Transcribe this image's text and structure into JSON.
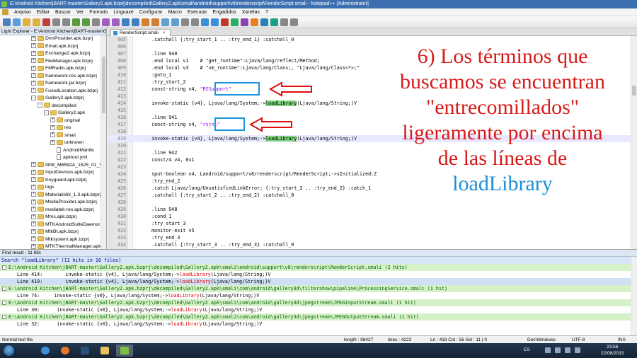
{
  "window": {
    "title": "E:\\Android Kitchen\\jBART-master\\Gallery2.apk.bzprj\\decompiled\\Gallery2.apk\\smali\\android\\support\\v8\\renderscript\\RenderScript.smali - Notepad++ [Administrator]"
  },
  "menu": [
    "Arquivo",
    "Editar",
    "Buscar",
    "Ver",
    "Formato",
    "Linguaxe",
    "Configurar",
    "Macro",
    "Executar",
    "Engadidos",
    "Xanelas",
    "?"
  ],
  "explorer": {
    "title": "Light Explorer - E:\\Android Kitchen\\jBART-master\\G...",
    "items": [
      {
        "label": "DrmProvider.apk.bzprj",
        "level": 3,
        "kind": "folder",
        "expander": "+"
      },
      {
        "label": "Email.apk.bzprj",
        "level": 3,
        "kind": "folder",
        "expander": "+"
      },
      {
        "label": "Exchange2.apk.bzprj",
        "level": 3,
        "kind": "folder",
        "expander": "+"
      },
      {
        "label": "FileManager.apk.bzprj",
        "level": 3,
        "kind": "folder",
        "expander": "+"
      },
      {
        "label": "FMRadio.apk.bzprj",
        "level": 3,
        "kind": "folder",
        "expander": "+"
      },
      {
        "label": "framework-res.apk.bzprj",
        "level": 3,
        "kind": "folder",
        "expander": "+"
      },
      {
        "label": "framework.jar.bzprj",
        "level": 3,
        "kind": "folder",
        "expander": "+"
      },
      {
        "label": "FusedLocation.apk.bzprj",
        "level": 3,
        "kind": "folder",
        "expander": "+"
      },
      {
        "label": "Gallery2.apk.bzprj",
        "level": 3,
        "kind": "folder",
        "expander": "-"
      },
      {
        "label": "decompiled",
        "level": 4,
        "kind": "folder",
        "expander": "-"
      },
      {
        "label": "Gallery2.apk",
        "level": 5,
        "kind": "folder",
        "expander": "-"
      },
      {
        "label": "original",
        "level": 6,
        "kind": "folder",
        "expander": "+"
      },
      {
        "label": "res",
        "level": 6,
        "kind": "folder",
        "expander": "+"
      },
      {
        "label": "smali",
        "level": 6,
        "kind": "folder",
        "expander": "+"
      },
      {
        "label": "unknown",
        "level": 6,
        "kind": "folder",
        "expander": "+"
      },
      {
        "label": "AndroidManife",
        "level": 6,
        "kind": "file",
        "expander": ""
      },
      {
        "label": "apktool.yml",
        "level": 6,
        "kind": "file",
        "expander": ""
      },
      {
        "label": "I908_M6592A_1525_01_V31",
        "level": 3,
        "kind": "folder",
        "expander": "+"
      },
      {
        "label": "InputDevices.apk.bzprj",
        "level": 3,
        "kind": "folder",
        "expander": "+"
      },
      {
        "label": "Keyguard.apk.bzprj",
        "level": 3,
        "kind": "folder",
        "expander": "+"
      },
      {
        "label": "logs",
        "level": 3,
        "kind": "folder",
        "expander": "+"
      },
      {
        "label": "Materialistik_1.3.apk.bzprj",
        "level": 3,
        "kind": "folder",
        "expander": "+"
      },
      {
        "label": "MediaProvider.apk.bzprj",
        "level": 3,
        "kind": "folder",
        "expander": "+"
      },
      {
        "label": "mediatek-res.apk.bzprj",
        "level": 3,
        "kind": "folder",
        "expander": "+"
      },
      {
        "label": "Mms.apk.bzprj",
        "level": 3,
        "kind": "folder",
        "expander": "+"
      },
      {
        "label": "MTKAndroidSuiteDaemor",
        "level": 3,
        "kind": "folder",
        "expander": "+"
      },
      {
        "label": "MtkBt.apk.bzprj",
        "level": 3,
        "kind": "folder",
        "expander": "+"
      },
      {
        "label": "Mtksystem.apk.bzprj",
        "level": 3,
        "kind": "folder",
        "expander": "+"
      },
      {
        "label": "MTKThermalManager.apk",
        "level": 3,
        "kind": "folder",
        "expander": "+"
      }
    ]
  },
  "tab": {
    "label": "RenderScript.smali",
    "close": "×"
  },
  "editor": {
    "current_line": 419,
    "lines": [
      {
        "n": "405",
        "text": "    .catchall {:try_start_1 .. :try_end_1} :catchall_0"
      },
      {
        "n": "406",
        "text": ""
      },
      {
        "n": "407",
        "text": "    .line 940"
      },
      {
        "n": "408",
        "text": "    .end local v1    # \"get_runtime\":Ljava/lang/reflect/Method;"
      },
      {
        "n": "409",
        "text": "    .end local v3    # \"vm_runtime\":Ljava/lang/Class;, \"Ljava/lang/Class<*>;\""
      },
      {
        "n": "410",
        "text": "    :goto_1"
      },
      {
        "n": "411",
        "text": "    :try_start_2"
      },
      {
        "n": "412",
        "pre": "    const-string v4, ",
        "quote": "\"RSSupport\"",
        "post": ""
      },
      {
        "n": "413",
        "text": ""
      },
      {
        "n": "414",
        "pre": "    invoke-static {v4}, Ljava/lang/System;->",
        "hl": "loadLibrary",
        "post": "(Ljava/lang/String;)V"
      },
      {
        "n": "415",
        "text": ""
      },
      {
        "n": "416",
        "text": "    .line 941"
      },
      {
        "n": "417",
        "pre": "    const-string v4, ",
        "quote": "\"rsjni\"",
        "post": ""
      },
      {
        "n": "418",
        "text": ""
      },
      {
        "n": "419",
        "pre": "    invoke-static {v4}, Ljava/lang/System;->",
        "hl": "loadLibrary",
        "post": "(Ljava/lang/String;)V"
      },
      {
        "n": "420",
        "text": ""
      },
      {
        "n": "421",
        "text": "    .line 942"
      },
      {
        "n": "422",
        "text": "    const/4 v4, 0x1"
      },
      {
        "n": "423",
        "text": ""
      },
      {
        "n": "424",
        "text": "    sput-boolean v4, Landroid/support/v8/renderscript/RenderScript;->sInitialized:Z"
      },
      {
        "n": "425",
        "text": "    :try_end_2"
      },
      {
        "n": "426",
        "text": "    .catch Ljava/lang/UnsatisfiedLinkError; {:try_start_2 .. :try_end_2} :catch_1"
      },
      {
        "n": "427",
        "text": "    .catchall {:try_start_2 .. :try_end_2} :catchall_0"
      },
      {
        "n": "428",
        "text": ""
      },
      {
        "n": "429",
        "text": "    .line 948"
      },
      {
        "n": "430",
        "text": "    :cond_1"
      },
      {
        "n": "431",
        "text": "    :try_start_3"
      },
      {
        "n": "432",
        "text": "    monitor-exit v5"
      },
      {
        "n": "433",
        "text": "    :try_end_3"
      },
      {
        "n": "434",
        "text": "    .catchall {:try_start_3 .. :try_end_3} :catchall_0"
      }
    ]
  },
  "annotation": {
    "lines": [
      "6) Los términos que",
      "buscamos se encuentran",
      "\"entrecomillados\"",
      "ligeramente por encima",
      "de las líneas de"
    ],
    "highlight": "loadLibrary",
    "color": "#d81a1a",
    "highlight_color": "#1a8fd8"
  },
  "find": {
    "title": "Find result - 11 hits",
    "search": "Search \"loadLibrary\" (11 hits in 10 files)",
    "rows": [
      {
        "kind": "file",
        "text": "E:\\Android Kitchen\\jBART-master\\Gallery2.apk.bzprj\\decompiled\\Gallery2.apk\\smali\\android\\support\\v8\\renderscript\\RenderScript.smali (2 hits)"
      },
      {
        "kind": "hit",
        "pre": "Line 414:        invoke-static {v4}, Ljava/lang/System;->",
        "hl": "loadLibrary",
        "post": "(Ljava/lang/String;)V"
      },
      {
        "kind": "hit",
        "sel": true,
        "pre": "Line 419:        invoke-static {v4}, Ljava/lang/System;->",
        "hl": "loadLibrary",
        "post": "(Ljava/lang/String;)V"
      },
      {
        "kind": "file",
        "text": "E:\\Android Kitchen\\jBART-master\\Gallery2.apk.bzprj\\decompiled\\Gallery2.apk\\smali\\com\\android\\gallery3d\\filtershow\\pipeline\\ProcessingService.smali (1 hit)"
      },
      {
        "kind": "hit",
        "pre": "Line 74:     invoke-static {v0}, Ljava/lang/System;->",
        "hl": "loadLibrary",
        "post": "(Ljava/lang/String;)V"
      },
      {
        "kind": "file",
        "text": "E:\\Android Kitchen\\jBART-master\\Gallery2.apk.bzprj\\decompiled\\Gallery2.apk\\smali\\com\\android\\gallery3d\\jpegstream\\JPEGInputStream.smali (1 hit)"
      },
      {
        "kind": "hit",
        "pre": "Line 30:      invoke-static {v0}, Ljava/lang/System;->",
        "hl": "loadLibrary",
        "post": "(Ljava/lang/String;)V"
      },
      {
        "kind": "file",
        "text": "E:\\Android Kitchen\\jBART-master\\Gallery2.apk.bzprj\\decompiled\\Gallery2.apk\\smali\\com\\android\\gallery3d\\jpegstream\\JPEGOutputStream.smali (1 hit)"
      },
      {
        "kind": "hit",
        "pre": "Line 32:      invoke-static {v0}, Ljava/lang/System;->",
        "hl": "loadLibrary",
        "post": "(Ljava/lang/String;)V"
      }
    ]
  },
  "status": {
    "type": "Normal text file",
    "length": "length : 98427",
    "lines": "lines : 4223",
    "pos": "Ln : 419   Col : 56   Sel : 11 | 0",
    "eol": "Dos\\Windows",
    "enc": "UTF-8",
    "mode": "INS"
  },
  "taskbar": {
    "lang": "ES",
    "time": "23:56",
    "date": "22/08/2015"
  },
  "colors": {
    "highlight_green": "#7fd67f",
    "box_blue": "#1b93e0",
    "arrow_red": "#e01010"
  }
}
